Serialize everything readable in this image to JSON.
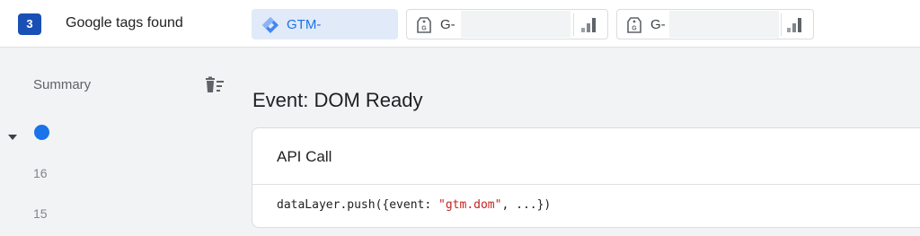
{
  "header": {
    "tag_count": "3",
    "found_label": "Google tags found",
    "tags": [
      {
        "id_prefix": "GTM-",
        "icon": "gtm-diamond-icon"
      },
      {
        "id_prefix": "G-",
        "icon": "google-tag-icon",
        "status_icon": "signal-bars-icon"
      },
      {
        "id_prefix": "G-",
        "icon": "google-tag-icon",
        "status_icon": "signal-bars-icon"
      }
    ]
  },
  "sidebar": {
    "summary_label": "Summary",
    "clear_icon": "delete-sweep-icon",
    "expand_icon": "caret-down-icon",
    "events": [
      "16",
      "15"
    ]
  },
  "main": {
    "event_title": "Event: DOM Ready",
    "card": {
      "title": "API Call",
      "code_prefix": "dataLayer.push({event: ",
      "code_string": "\"gtm.dom\"",
      "code_suffix": ", ...})"
    }
  },
  "colors": {
    "badge": "#1a4fb5",
    "accent": "#1a73e8",
    "string": "#c5221f"
  }
}
